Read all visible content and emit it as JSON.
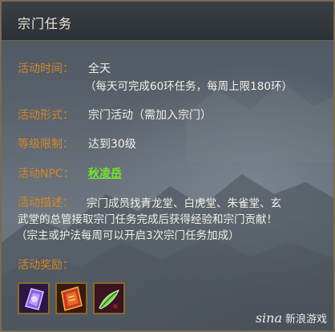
{
  "panel": {
    "title": "宗门任务"
  },
  "rows": {
    "time": {
      "label": "活动时间：",
      "value": "全天",
      "note": "（每天可完成60环任务，每周上限180环）"
    },
    "form": {
      "label": "活动形式：",
      "value": "宗门活动（需加入宗门）"
    },
    "level": {
      "label": "等级限制：",
      "value": "达到30级"
    },
    "npc": {
      "label": "活动NPC：",
      "value": "秋凌岳"
    },
    "description": {
      "label": "活动描述：",
      "line1": "宗门成员找青龙堂、白虎堂、朱雀堂、玄",
      "line2": "武堂的总管接取宗门任务完成后获得经验和宗门贡献！",
      "line3": "（宗主或护法每周可以开启3次宗门任务加成）"
    },
    "rewards": {
      "label": "活动奖励："
    }
  },
  "rewards": [
    {
      "icon": "purple-token-icon"
    },
    {
      "icon": "red-scroll-icon"
    },
    {
      "icon": "green-herb-icon"
    }
  ],
  "watermark": {
    "logo": "sina",
    "text": "新浪游戏"
  },
  "colors": {
    "label": "#d48528",
    "value": "#f2efe6",
    "link": "#74e52c",
    "titlebar": "#2d3137"
  }
}
